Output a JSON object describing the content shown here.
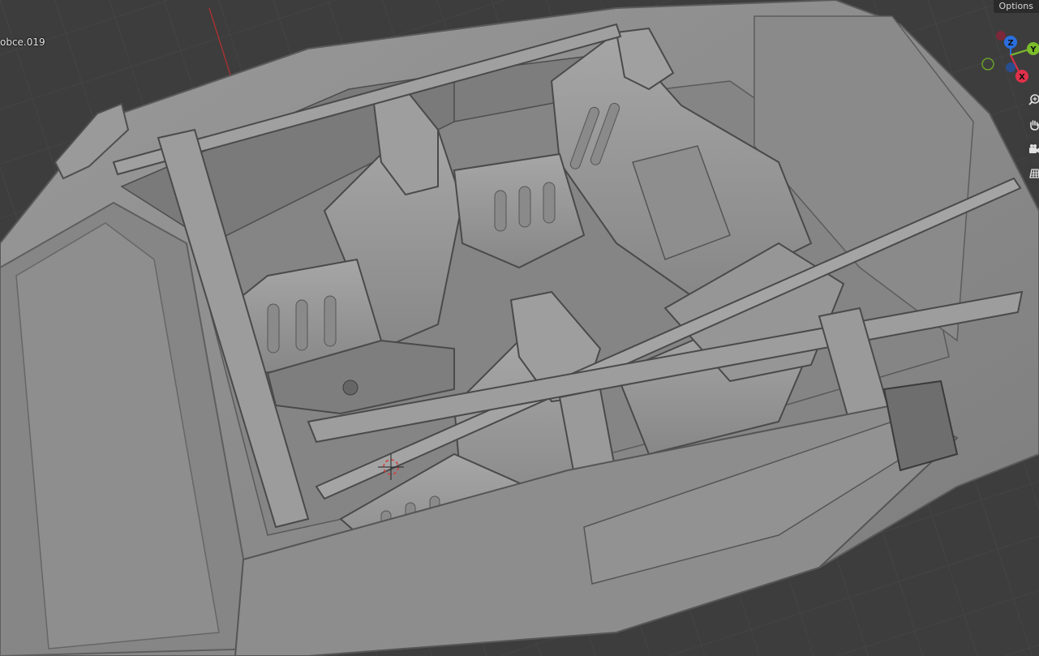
{
  "viewport": {
    "object_name": "obce.019",
    "options_label": "Options"
  },
  "gizmo": {
    "axes": [
      {
        "label": "Z",
        "color": "#2a6fe0"
      },
      {
        "label": "Y",
        "color": "#7bbd2a"
      },
      {
        "label": "X",
        "color": "#e0304a"
      }
    ]
  },
  "nav_tools": [
    {
      "name": "zoom",
      "icon": "zoom-icon"
    },
    {
      "name": "pan",
      "icon": "hand-icon"
    },
    {
      "name": "camera",
      "icon": "camera-icon"
    },
    {
      "name": "perspective",
      "icon": "grid-icon"
    }
  ],
  "colors": {
    "grid_bg": "#3d3d3d",
    "grid_line": "#474747",
    "mesh": "#8c8c8c",
    "x_axis_line": "#b03030"
  }
}
